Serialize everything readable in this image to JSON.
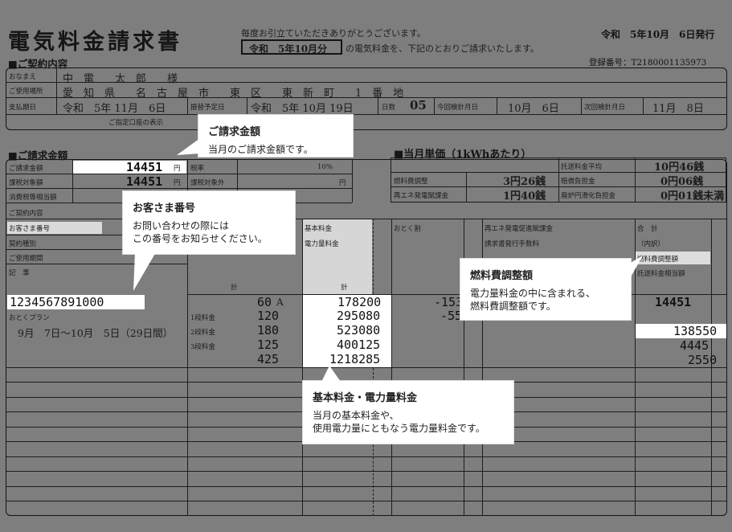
{
  "header": {
    "title": "電気料金請求書",
    "greeting_line1": "毎度お引立ていただきありがとうございます。",
    "period_label": "令和　5年10月分",
    "greeting_line2": "の電気料金を、下記のとおりご請求いたします。",
    "issue_date": "令和　5年10月　6日発行",
    "registration": "登録番号：T2180001135973"
  },
  "contract": {
    "section_title": "■ご契約内容",
    "name_label": "おなまえ",
    "name_value": "中　電　　太　郎　　様",
    "address_label": "ご使用場所",
    "address_value": "愛　知　県　　名　古　屋　市　　東　区　　東　新　町　　1　番　地",
    "payday_label": "支払期日",
    "payday_value": "令和　5年 11月　6日",
    "transfer_label": "振替予定日",
    "transfer_value": "令和　5年 10月 19日",
    "days_label": "日数",
    "days_value": "05",
    "this_meter_label": "今回検針月日",
    "this_meter_value": "10月　6日",
    "next_meter_label": "次回検針月日",
    "next_meter_value": "11月　8日",
    "account_note": "ご指定口座の表示"
  },
  "billing": {
    "section_title": "■ご請求金額",
    "rows": [
      {
        "label": "ご請求金額",
        "value": "14451",
        "unit": "円"
      },
      {
        "label": "課税対象額",
        "value": "14451",
        "unit": "円"
      },
      {
        "label": "消費税等相当額",
        "value": "",
        "unit": ""
      }
    ],
    "tax_rate_label": "税率",
    "tax_rate_value": "10%",
    "non_taxable_label": "課税対象外",
    "non_taxable_unit": "円",
    "contract_detail_label": "ご契約内容",
    "customer_no_label": "お客さま番号",
    "customer_no_value": "1234567891000",
    "contract_type_label": "契約種別",
    "use_period_label": "ご使用期間",
    "notes_label": "記　事",
    "plan_label": "おとくプラン",
    "period_value": "9月　7日〜10月　5日（29日間）",
    "total_label": "計"
  },
  "unit_price": {
    "section_title": "■当月単価（1kWhあたり）",
    "fuel_label": "燃料費調整",
    "fuel_value": "3円26銭",
    "renew_label": "再エネ発電賦課金",
    "renew_value": "1円40銭",
    "avg_label": "託送料金平均",
    "avg_value": "10円46銭",
    "compensation_label": "賠償負担金",
    "compensation_value": "0円06銭",
    "decom_label": "廃炉円滑化負担金",
    "decom_value": "0円01銭未満"
  },
  "usage": {
    "basic_label": "基本料金",
    "energy_label": "電力量料金",
    "discount_label": "おとく割",
    "renew_fee_label": "再エネ発電促進賦課金",
    "invoice_fee_label": "請求書発行手数料",
    "sum_label": "合　計",
    "incl_label": "（内訳）",
    "fuel_adj_label": "燃料費調整額",
    "wheeling_label": "託送料金相当額",
    "yen": "円",
    "sen": "銭",
    "kw_value": "60",
    "kw_unit": "A",
    "tiers": [
      {
        "label": "1段料金",
        "kwh": "120",
        "amount": "295080"
      },
      {
        "label": "2段料金",
        "kwh": "180",
        "amount": "523080"
      },
      {
        "label": "3段料金",
        "kwh": "125",
        "amount": "400125"
      }
    ],
    "total_kwh": "425",
    "total_amount": "1218285",
    "basic_amount": "178200",
    "discount_value": "-153",
    "discount_value2": "-55",
    "grand_total": "14451",
    "fuel_adj_value": "138550",
    "wheeling_value": "4445",
    "extra_value": "2550"
  },
  "callouts": [
    {
      "title": "ご請求金額",
      "body": "当月のご請求金額です。"
    },
    {
      "title": "お客さま番号",
      "body": "お問い合わせの際には\nこの番号をお知らせください。"
    },
    {
      "title": "燃料費調整額",
      "body": "電力量料金の中に含まれる、\n燃料費調整額です。"
    },
    {
      "title": "基本料金・電力量料金",
      "body": "当月の基本料金や、\n使用電力量にともなう電力量料金です。"
    }
  ]
}
